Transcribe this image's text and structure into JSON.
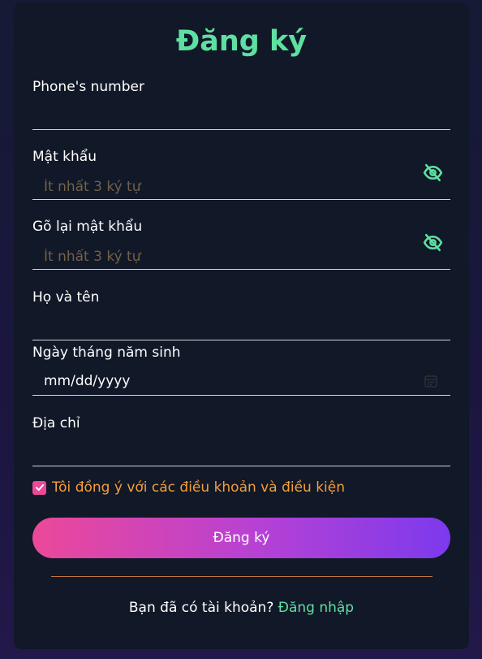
{
  "form": {
    "title": "Đăng ký",
    "phone": {
      "label": "Phone's number",
      "value": "",
      "placeholder": ""
    },
    "password": {
      "label": "Mật khẩu",
      "value": "",
      "placeholder": "Ít nhất 3 ký tự",
      "toggle_icon": "eye-slash-icon"
    },
    "confirm_password": {
      "label": "Gõ lại mật khẩu",
      "value": "",
      "placeholder": "Ít nhất 3 ký tự",
      "toggle_icon": "eye-slash-icon"
    },
    "full_name": {
      "label": "Họ và tên",
      "value": "",
      "placeholder": ""
    },
    "birthdate": {
      "label": "Ngày tháng năm sinh",
      "value": "mm/dd/yyyy",
      "icon": "calendar-icon"
    },
    "address": {
      "label": "Địa chỉ",
      "value": "",
      "placeholder": ""
    },
    "agree": {
      "label": "Tôi đồng ý với các điều khoản và điều kiện",
      "checked": true
    },
    "submit_label": "Đăng ký",
    "login_prompt": "Bạn đã có tài khoản?",
    "login_link": "Đăng nhập"
  },
  "colors": {
    "accent_green": "#5ee0a2",
    "accent_orange": "#f59e3a",
    "gradient_start": "#ec4899",
    "gradient_end": "#7c3aed",
    "card_bg": "#111827"
  }
}
